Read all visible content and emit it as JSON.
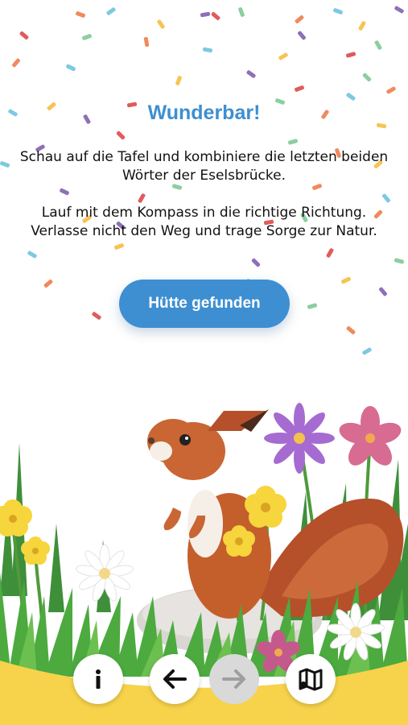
{
  "celebration": {
    "title": "Wunderbar!",
    "paragraph1": "Schau auf die Tafel und kombiniere die letzten beiden Wörter der Eselsbrücke.",
    "paragraph2": "Lauf mit dem Kompass in die richtige Richtung. Verlasse nicht den Weg und trage Sorge zur Natur."
  },
  "primary_button": {
    "label": "Hütte gefunden"
  },
  "nav": {
    "items": [
      {
        "icon": "info-icon",
        "enabled": true
      },
      {
        "icon": "arrow-left-icon",
        "enabled": true
      },
      {
        "icon": "arrow-right-icon",
        "enabled": false
      },
      {
        "icon": "map-icon",
        "enabled": true
      }
    ]
  },
  "colors": {
    "accent": "#3d8fd1",
    "nav_bar": "#f6d34a",
    "disabled_button": "#d9d9d9",
    "confetti": [
      "#f08a5d",
      "#7ec8e3",
      "#f6c453",
      "#8e6fb8",
      "#e05b5b",
      "#8bcf9e"
    ]
  }
}
